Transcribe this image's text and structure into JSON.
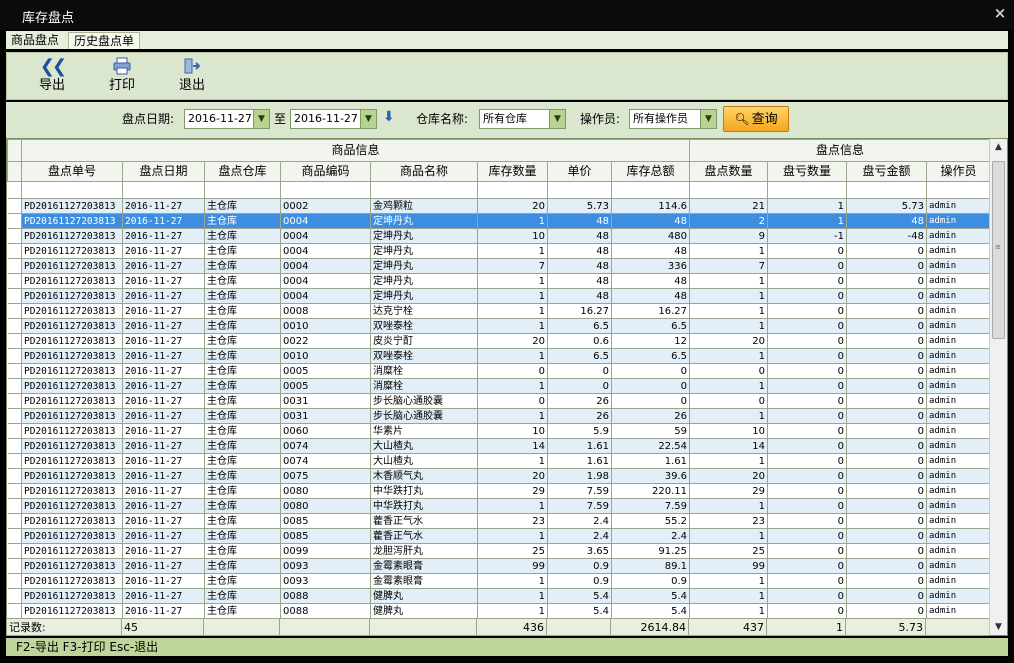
{
  "window": {
    "title": "库存盘点",
    "close_glyph": "×"
  },
  "tabs": [
    {
      "label": "商品盘点"
    },
    {
      "label": "历史盘点单"
    }
  ],
  "toolbar": {
    "export_label": "导出",
    "export_icon": "double-chevron-left-icon",
    "print_label": "打印",
    "print_icon": "printer-icon",
    "exit_label": "退出",
    "exit_icon": "exit-door-icon"
  },
  "filter": {
    "date_label": "盘点日期:",
    "date_from": "2016-11-27",
    "to_label": "至",
    "date_to": "2016-11-27",
    "warehouse_label": "仓库名称:",
    "warehouse_value": "所有仓库",
    "operator_label": "操作员:",
    "operator_value": "所有操作员",
    "query_label": "查询"
  },
  "grid": {
    "group_headers": [
      "商品信息",
      "盘点信息"
    ],
    "columns": [
      "盘点单号",
      "盘点日期",
      "盘点仓库",
      "商品编码",
      "商品名称",
      "库存数量",
      "单价",
      "库存总额",
      "盘点数量",
      "盘亏数量",
      "盘亏金额",
      "操作员"
    ],
    "selected_index": 1,
    "rows": [
      [
        "PD20161127203813",
        "2016-11-27",
        "主仓库",
        "0002",
        "金鸡颗粒",
        "20",
        "5.73",
        "114.6",
        "21",
        "1",
        "5.73",
        "admin"
      ],
      [
        "PD20161127203813",
        "2016-11-27",
        "主仓库",
        "0004",
        "定坤丹丸",
        "1",
        "48",
        "48",
        "2",
        "1",
        "48",
        "admin"
      ],
      [
        "PD20161127203813",
        "2016-11-27",
        "主仓库",
        "0004",
        "定坤丹丸",
        "10",
        "48",
        "480",
        "9",
        "-1",
        "-48",
        "admin"
      ],
      [
        "PD20161127203813",
        "2016-11-27",
        "主仓库",
        "0004",
        "定坤丹丸",
        "1",
        "48",
        "48",
        "1",
        "0",
        "0",
        "admin"
      ],
      [
        "PD20161127203813",
        "2016-11-27",
        "主仓库",
        "0004",
        "定坤丹丸",
        "7",
        "48",
        "336",
        "7",
        "0",
        "0",
        "admin"
      ],
      [
        "PD20161127203813",
        "2016-11-27",
        "主仓库",
        "0004",
        "定坤丹丸",
        "1",
        "48",
        "48",
        "1",
        "0",
        "0",
        "admin"
      ],
      [
        "PD20161127203813",
        "2016-11-27",
        "主仓库",
        "0004",
        "定坤丹丸",
        "1",
        "48",
        "48",
        "1",
        "0",
        "0",
        "admin"
      ],
      [
        "PD20161127203813",
        "2016-11-27",
        "主仓库",
        "0008",
        "达克宁栓",
        "1",
        "16.27",
        "16.27",
        "1",
        "0",
        "0",
        "admin"
      ],
      [
        "PD20161127203813",
        "2016-11-27",
        "主仓库",
        "0010",
        "双唑泰栓",
        "1",
        "6.5",
        "6.5",
        "1",
        "0",
        "0",
        "admin"
      ],
      [
        "PD20161127203813",
        "2016-11-27",
        "主仓库",
        "0022",
        "皮炎宁酊",
        "20",
        "0.6",
        "12",
        "20",
        "0",
        "0",
        "admin"
      ],
      [
        "PD20161127203813",
        "2016-11-27",
        "主仓库",
        "0010",
        "双唑泰栓",
        "1",
        "6.5",
        "6.5",
        "1",
        "0",
        "0",
        "admin"
      ],
      [
        "PD20161127203813",
        "2016-11-27",
        "主仓库",
        "0005",
        "消糜栓",
        "0",
        "0",
        "0",
        "0",
        "0",
        "0",
        "admin"
      ],
      [
        "PD20161127203813",
        "2016-11-27",
        "主仓库",
        "0005",
        "消糜栓",
        "1",
        "0",
        "0",
        "1",
        "0",
        "0",
        "admin"
      ],
      [
        "PD20161127203813",
        "2016-11-27",
        "主仓库",
        "0031",
        "步长脑心通胶囊",
        "0",
        "26",
        "0",
        "0",
        "0",
        "0",
        "admin"
      ],
      [
        "PD20161127203813",
        "2016-11-27",
        "主仓库",
        "0031",
        "步长脑心通胶囊",
        "1",
        "26",
        "26",
        "1",
        "0",
        "0",
        "admin"
      ],
      [
        "PD20161127203813",
        "2016-11-27",
        "主仓库",
        "0060",
        "华素片",
        "10",
        "5.9",
        "59",
        "10",
        "0",
        "0",
        "admin"
      ],
      [
        "PD20161127203813",
        "2016-11-27",
        "主仓库",
        "0074",
        "大山楂丸",
        "14",
        "1.61",
        "22.54",
        "14",
        "0",
        "0",
        "admin"
      ],
      [
        "PD20161127203813",
        "2016-11-27",
        "主仓库",
        "0074",
        "大山楂丸",
        "1",
        "1.61",
        "1.61",
        "1",
        "0",
        "0",
        "admin"
      ],
      [
        "PD20161127203813",
        "2016-11-27",
        "主仓库",
        "0075",
        "木香顺气丸",
        "20",
        "1.98",
        "39.6",
        "20",
        "0",
        "0",
        "admin"
      ],
      [
        "PD20161127203813",
        "2016-11-27",
        "主仓库",
        "0080",
        "中华跌打丸",
        "29",
        "7.59",
        "220.11",
        "29",
        "0",
        "0",
        "admin"
      ],
      [
        "PD20161127203813",
        "2016-11-27",
        "主仓库",
        "0080",
        "中华跌打丸",
        "1",
        "7.59",
        "7.59",
        "1",
        "0",
        "0",
        "admin"
      ],
      [
        "PD20161127203813",
        "2016-11-27",
        "主仓库",
        "0085",
        "藿香正气水",
        "23",
        "2.4",
        "55.2",
        "23",
        "0",
        "0",
        "admin"
      ],
      [
        "PD20161127203813",
        "2016-11-27",
        "主仓库",
        "0085",
        "藿香正气水",
        "1",
        "2.4",
        "2.4",
        "1",
        "0",
        "0",
        "admin"
      ],
      [
        "PD20161127203813",
        "2016-11-27",
        "主仓库",
        "0099",
        "龙胆泻肝丸",
        "25",
        "3.65",
        "91.25",
        "25",
        "0",
        "0",
        "admin"
      ],
      [
        "PD20161127203813",
        "2016-11-27",
        "主仓库",
        "0093",
        "金霉素眼膏",
        "99",
        "0.9",
        "89.1",
        "99",
        "0",
        "0",
        "admin"
      ],
      [
        "PD20161127203813",
        "2016-11-27",
        "主仓库",
        "0093",
        "金霉素眼膏",
        "1",
        "0.9",
        "0.9",
        "1",
        "0",
        "0",
        "admin"
      ],
      [
        "PD20161127203813",
        "2016-11-27",
        "主仓库",
        "0088",
        "健脾丸",
        "1",
        "5.4",
        "5.4",
        "1",
        "0",
        "0",
        "admin"
      ],
      [
        "PD20161127203813",
        "2016-11-27",
        "主仓库",
        "0088",
        "健脾丸",
        "1",
        "5.4",
        "5.4",
        "1",
        "0",
        "0",
        "admin"
      ]
    ]
  },
  "summary": {
    "record_label": "记录数:",
    "record_count": "45",
    "stock_qty_total": "436",
    "stock_amount_total": "2614.84",
    "count_qty_total": "437",
    "loss_qty_total": "1",
    "loss_amount_total": "5.73"
  },
  "status_bar": "F2-导出 F3-打印 Esc-退出",
  "colors": {
    "selected_row": "#3d8ee0",
    "alt_row": "#e2eef8",
    "toolbar_bg": "#dbe6cf",
    "status_bg": "#bfd59c",
    "query_button": "#f3a61c"
  }
}
